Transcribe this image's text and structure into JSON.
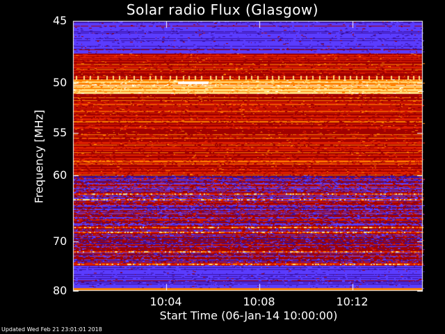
{
  "chart_data": {
    "type": "heatmap",
    "title": "Solar radio Flux (Glasgow)",
    "xlabel": "Start Time (06-Jan-14 10:00:00)",
    "ylabel": "Frequency [MHz]",
    "x_ticks": [
      "10:04",
      "10:08",
      "10:12"
    ],
    "y_ticks": [
      "45",
      "50",
      "55",
      "60",
      "70",
      "80"
    ],
    "y_tick_values": [
      45,
      50,
      55,
      60,
      70,
      80
    ],
    "x_tick_minutes": [
      4,
      8,
      12
    ],
    "xlim_minutes": [
      0,
      15
    ],
    "ylim_mhz": [
      45,
      80
    ],
    "y_scale": "reciprocal (MHz decreasing downward)",
    "colormap": [
      "#1a0030",
      "#3a10a0",
      "#5a3cff",
      "#a00000",
      "#e02000",
      "#ff8000",
      "#ffe080",
      "#ffffff"
    ],
    "bands": [
      {
        "from": 45,
        "to": 47.5,
        "level": "low"
      },
      {
        "from": 47.5,
        "to": 49.7,
        "level": "high"
      },
      {
        "from": 49.7,
        "to": 51.0,
        "level": "very-high"
      },
      {
        "from": 51.0,
        "to": 60.0,
        "level": "high"
      },
      {
        "from": 60.0,
        "to": 66.0,
        "level": "medium"
      },
      {
        "from": 66.0,
        "to": 74.5,
        "level": "medium"
      },
      {
        "from": 74.5,
        "to": 79.5,
        "level": "low"
      },
      {
        "from": 79.5,
        "to": 80,
        "level": "very-high"
      }
    ]
  },
  "footer": "Updated Wed Feb 21 23:01:01 2018"
}
